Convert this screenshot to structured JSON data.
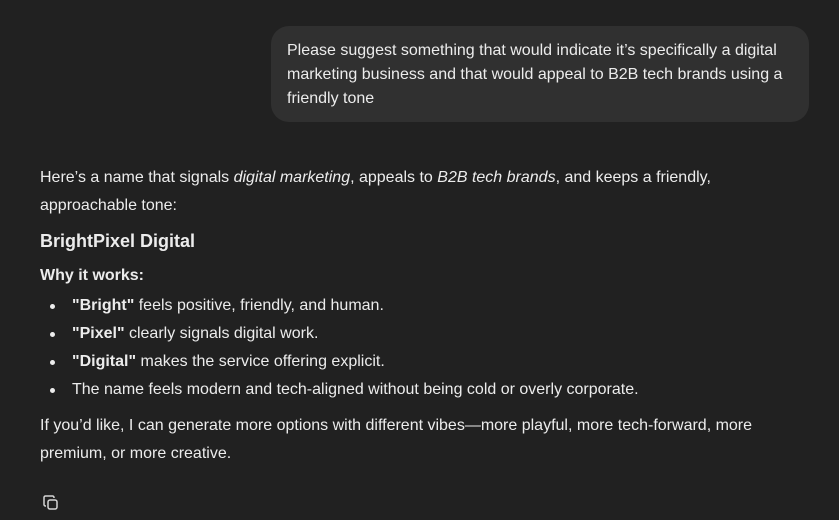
{
  "user_message": "Please suggest something that would indicate it’s specifically a digital marketing business and that would appeal to B2B tech brands using a friendly tone",
  "reply": {
    "intro_1": "Here’s a name that signals ",
    "intro_em_1": "digital marketing",
    "intro_2": ", appeals to ",
    "intro_em_2": "B2B tech brands",
    "intro_3": ", and keeps a friendly, approachable tone:",
    "name_heading": "BrightPixel Digital",
    "why_heading": "Why it works:",
    "points": [
      {
        "term": "\"Bright\"",
        "text": " feels positive, friendly, and human."
      },
      {
        "term": "\"Pixel\"",
        "text": " clearly signals digital work."
      },
      {
        "term": "\"Digital\"",
        "text": " makes the service offering explicit."
      },
      {
        "term": "",
        "text": "The name feels modern and tech-aligned without being cold or overly corporate."
      }
    ],
    "closing": "If you’d like, I can generate more options with different vibes—more playful, more tech-forward, more premium, or more creative."
  },
  "icons": {
    "copy": "copy-icon"
  }
}
